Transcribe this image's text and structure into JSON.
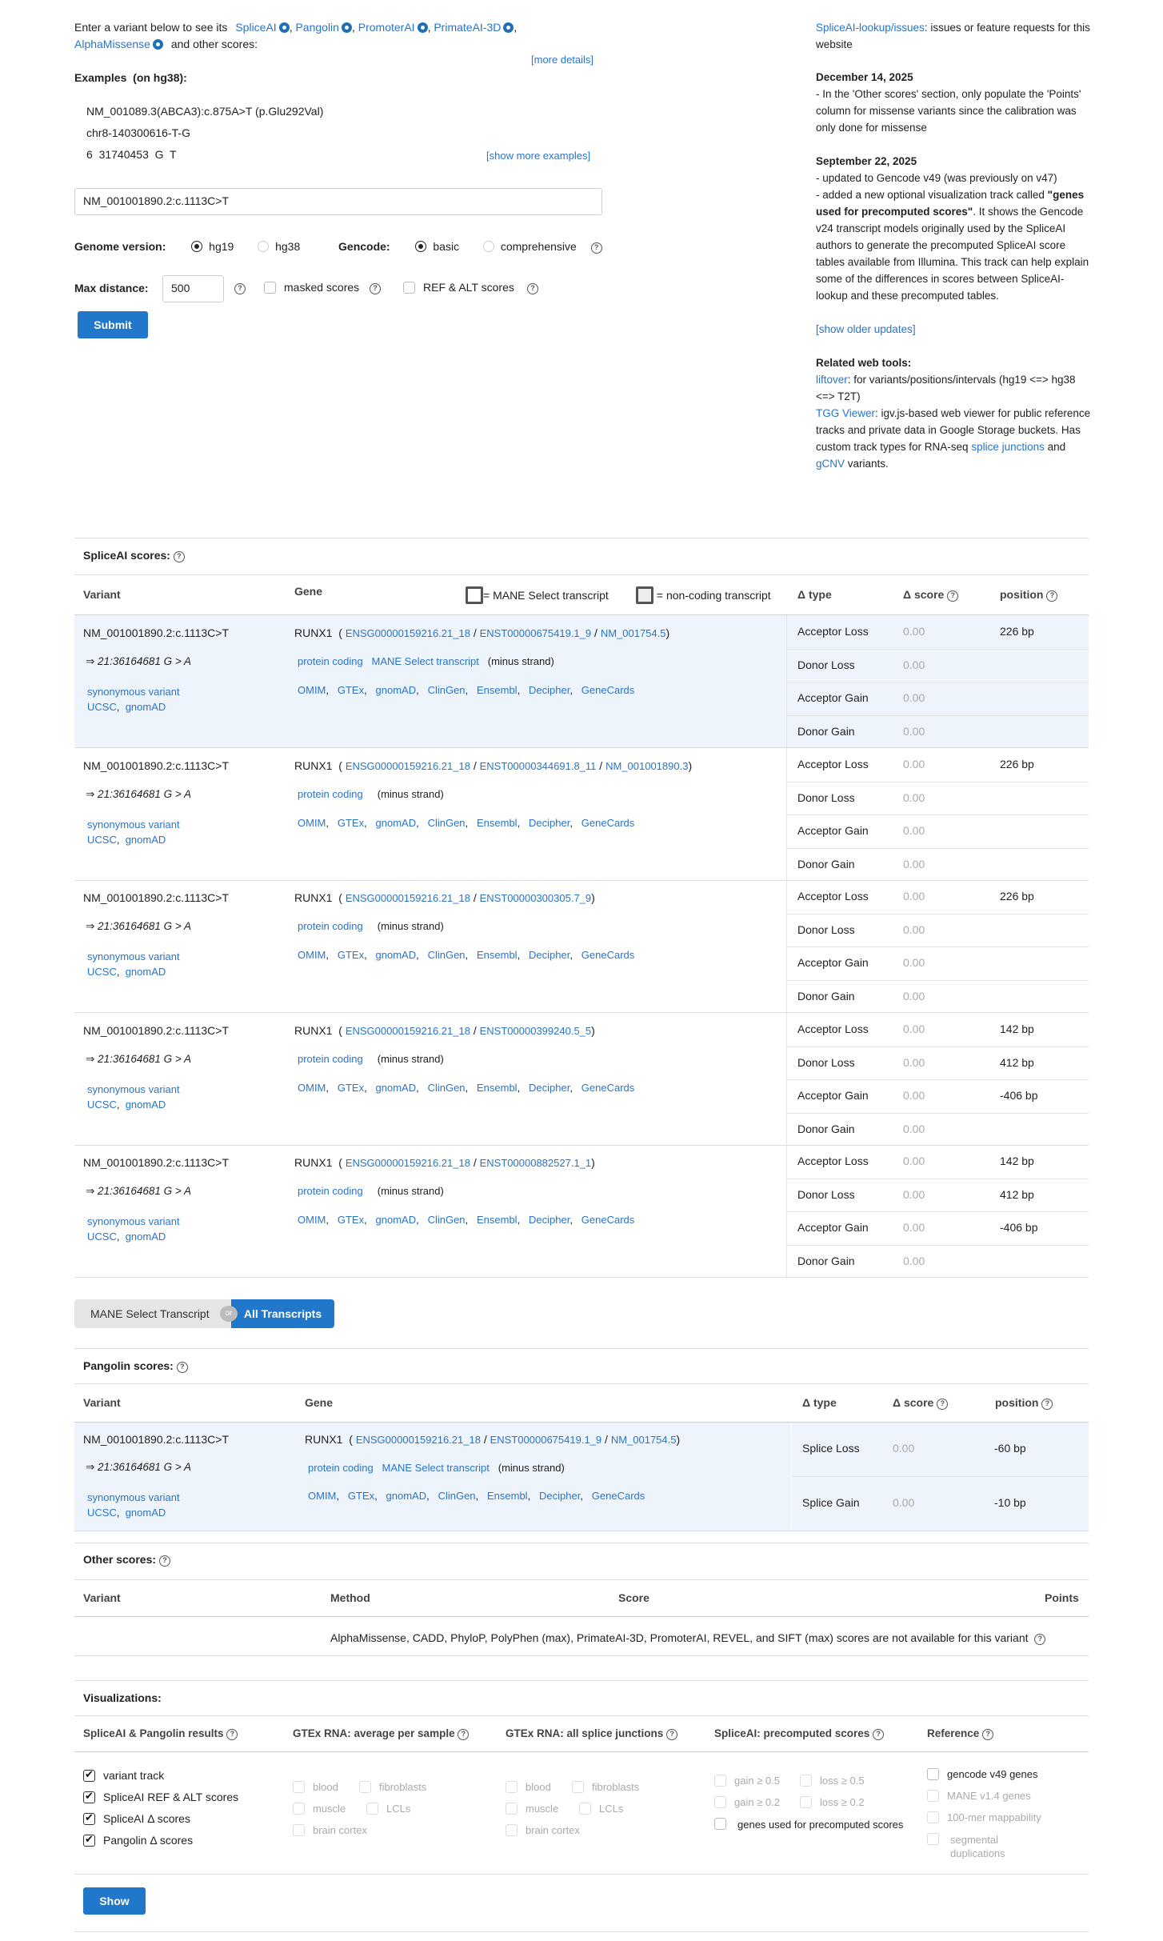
{
  "intro": {
    "prefix": "Enter a variant below to see its",
    "tools": [
      "SpliceAI",
      "Pangolin",
      "PromoterAI",
      "PrimateAI-3D",
      "AlphaMissense"
    ],
    "suffix": "and other scores:",
    "more_details": "[more details]",
    "examples_label": "Examples",
    "examples_genome": "(on hg38):",
    "examples": [
      "NM_001089.3(ABCA3):c.875A>T (p.Glu292Val)",
      "chr8-140300616-T-G",
      "6  31740453  G  T"
    ],
    "show_more": "[show more examples]",
    "variant_value": "NM_001001890.2:c.1113C>T",
    "genome_label": "Genome version:",
    "genome_options": [
      "hg19",
      "hg38"
    ],
    "gencode_label": "Gencode:",
    "gencode_options": [
      "basic",
      "comprehensive"
    ],
    "max_distance_label": "Max distance:",
    "max_distance_value": "500",
    "masked_label": "masked scores",
    "refalt_label": "REF & ALT scores",
    "submit": "Submit"
  },
  "sidebar": {
    "issues_link": "SpliceAI-lookup/issues",
    "issues_text": ": issues or feature requests for this website",
    "update1_date": "December 14, 2025",
    "update1_text": "- In the 'Other scores' section, only populate the 'Points' column for missense variants since the calibration was only done for missense",
    "update2_date": "September 22, 2025",
    "update2_line1": "- updated to Gencode v49 (was previously on v47)",
    "update2_line2a": "- added a new optional visualization track called ",
    "update2_bold": "\"genes used for precomputed scores\"",
    "update2_line2b": ". It shows the Gencode v24 transcript models originally used by the SpliceAI authors to generate the precomputed SpliceAI score tables available from Illumina. This track can help explain some of the differences in scores between SpliceAI-lookup and these precomputed tables.",
    "older_updates": "[show older updates]",
    "related_label": "Related web tools:",
    "liftover_link": "liftover",
    "liftover_text": ": for variants/positions/intervals (hg19 <=> hg38 <=> T2T)",
    "tgg_link": "TGG Viewer",
    "tgg_text": ": igv.js-based web viewer for public reference tracks and private data in Google Storage buckets. Has custom track types for RNA-seq ",
    "splice_link": "splice junctions",
    "and_text": " and ",
    "gcnv_link": "gCNV",
    "variants_text": " variants."
  },
  "spliceai": {
    "title": "SpliceAI scores:",
    "headers": {
      "variant": "Variant",
      "gene": "Gene",
      "mane_legend": "= MANE Select transcript",
      "noncoding_legend": "= non-coding transcript",
      "dtype": "Δ type",
      "dscore": "Δ score",
      "position": "position"
    },
    "variant": "NM_001001890.2:c.1113C>T",
    "coord": "⇒ 21:36164681 G > A",
    "consequence": "synonymous variant",
    "ucsc": "UCSC",
    "gnomad": "gnomAD",
    "gene": "RUNX1",
    "links": [
      "OMIM",
      "GTEx",
      "gnomAD",
      "ClinGen",
      "Ensembl",
      "Decipher",
      "GeneCards"
    ],
    "types": [
      "Acceptor Loss",
      "Donor Loss",
      "Acceptor Gain",
      "Donor Gain"
    ],
    "score": "0.00",
    "strand": "(minus strand)",
    "protein_coding": "protein coding",
    "mane_tag": "MANE Select transcript",
    "rows": [
      {
        "gene_id": "ENSG00000159216.21_18",
        "tx": "ENST00000675419.1_9",
        "refseq": "NM_001754.5",
        "mane": true,
        "positions": [
          "226 bp",
          "",
          "",
          ""
        ]
      },
      {
        "gene_id": "ENSG00000159216.21_18",
        "tx": "ENST00000344691.8_11",
        "refseq": "NM_001001890.3",
        "mane": false,
        "positions": [
          "226 bp",
          "",
          "",
          ""
        ]
      },
      {
        "gene_id": "ENSG00000159216.21_18",
        "tx": "ENST00000300305.7_9",
        "refseq": "",
        "mane": false,
        "positions": [
          "226 bp",
          "",
          "",
          ""
        ]
      },
      {
        "gene_id": "ENSG00000159216.21_18",
        "tx": "ENST00000399240.5_5",
        "refseq": "",
        "mane": false,
        "positions": [
          "142 bp",
          "412 bp",
          "-406 bp",
          ""
        ]
      },
      {
        "gene_id": "ENSG00000159216.21_18",
        "tx": "ENST00000882527.1_1",
        "refseq": "",
        "mane": false,
        "positions": [
          "142 bp",
          "412 bp",
          "-406 bp",
          ""
        ]
      }
    ]
  },
  "toggle": {
    "mane": "MANE Select Transcript",
    "or": "or",
    "all": "All Transcripts"
  },
  "pangolin": {
    "title": "Pangolin scores:",
    "headers": {
      "variant": "Variant",
      "gene": "Gene",
      "dtype": "Δ type",
      "dscore": "Δ score",
      "position": "position"
    },
    "types": [
      "Splice Loss",
      "Splice Gain"
    ],
    "positions": [
      "-60 bp",
      "-10 bp"
    ]
  },
  "other": {
    "title": "Other scores:",
    "headers": {
      "variant": "Variant",
      "method": "Method",
      "score": "Score",
      "points": "Points"
    },
    "message": "AlphaMissense,  CADD,  PhyloP,  PolyPhen (max),  PrimateAI-3D,  PromoterAI,  REVEL,  and SIFT (max) scores are not available for this variant"
  },
  "viz": {
    "title": "Visualizations:",
    "col1_title": "SpliceAI & Pangolin results",
    "col1_items": [
      "variant track",
      "SpliceAI REF & ALT scores",
      "SpliceAI Δ  scores",
      "Pangolin Δ  scores"
    ],
    "col2_title": "GTEx RNA: average per sample",
    "col3_title": "GTEx RNA: all splice junctions",
    "tissues": [
      "blood",
      "fibroblasts",
      "muscle",
      "LCLs",
      "brain cortex"
    ],
    "col4_title": "SpliceAI: precomputed scores",
    "col4_items": [
      "gain ≥ 0.5",
      "loss ≥ 0.5",
      "gain ≥ 0.2",
      "loss ≥ 0.2"
    ],
    "col4_genes": "genes used for precomputed scores",
    "col5_title": "Reference",
    "col5_items": [
      "gencode v49 genes",
      "MANE v1.4 genes",
      "100-mer mappability",
      "segmental duplications"
    ],
    "show": "Show"
  },
  "colors": {
    "accent": "#2177c9",
    "mane_row_bg": "#eef4fb",
    "link": "#2a74c7"
  }
}
